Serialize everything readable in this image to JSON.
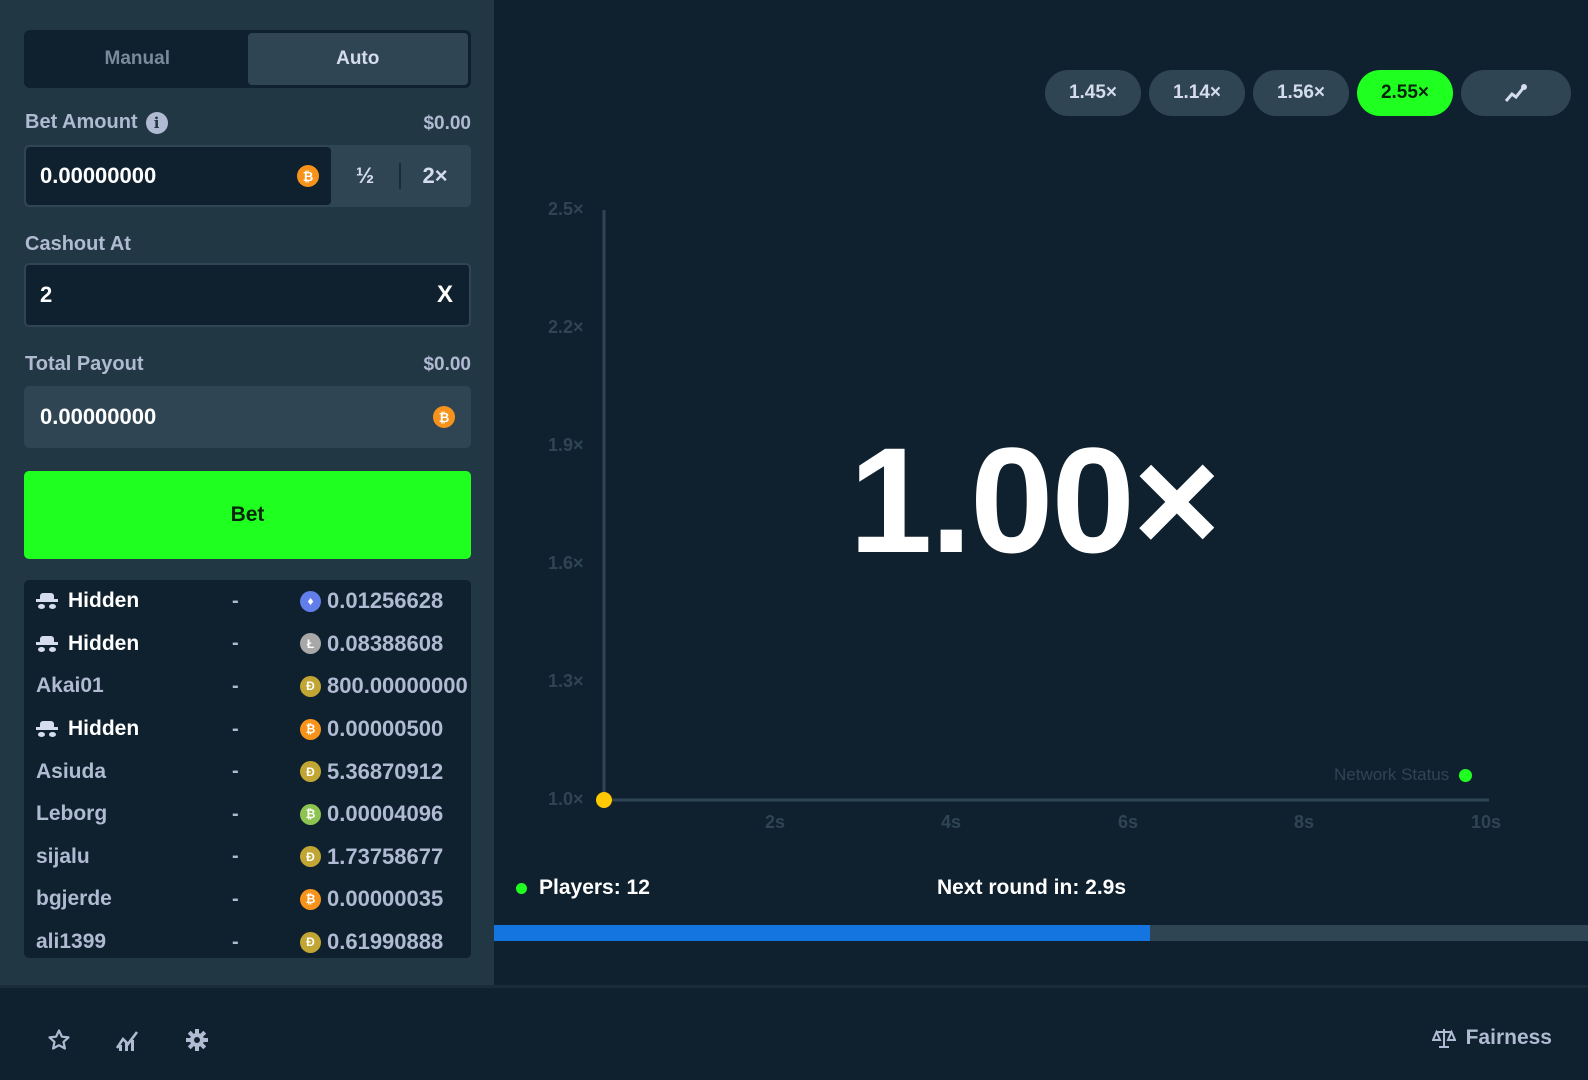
{
  "tabs": {
    "manual": "Manual",
    "auto": "Auto"
  },
  "bet_amount": {
    "label": "Bet Amount",
    "usd": "$0.00",
    "value": "0.00000000",
    "half": "½",
    "double": "2×"
  },
  "cashout": {
    "label": "Cashout At",
    "value": "2",
    "clear": "X"
  },
  "payout": {
    "label": "Total Payout",
    "usd": "$0.00",
    "value": "0.00000000"
  },
  "bet_button": "Bet",
  "players": [
    {
      "name": "Hidden",
      "hidden": true,
      "dash": "-",
      "coin": "eth",
      "amount": "0.01256628"
    },
    {
      "name": "Hidden",
      "hidden": true,
      "dash": "-",
      "coin": "ltc",
      "amount": "0.08388608"
    },
    {
      "name": "Akai01",
      "hidden": false,
      "dash": "-",
      "coin": "doge",
      "amount": "800.00000000"
    },
    {
      "name": "Hidden",
      "hidden": true,
      "dash": "-",
      "coin": "btc",
      "amount": "0.00000500"
    },
    {
      "name": "Asiuda",
      "hidden": false,
      "dash": "-",
      "coin": "doge",
      "amount": "5.36870912"
    },
    {
      "name": "Leborg",
      "hidden": false,
      "dash": "-",
      "coin": "bch",
      "amount": "0.00004096"
    },
    {
      "name": "sijalu",
      "hidden": false,
      "dash": "-",
      "coin": "doge",
      "amount": "1.73758677"
    },
    {
      "name": "bgjerde",
      "hidden": false,
      "dash": "-",
      "coin": "btc",
      "amount": "0.00000035"
    },
    {
      "name": "ali1399",
      "hidden": false,
      "dash": "-",
      "coin": "doge",
      "amount": "0.61990888"
    }
  ],
  "coin_colors": {
    "eth": "#627eea",
    "ltc": "#a8a8a8",
    "doge": "#c2a633",
    "btc": "#f7931a",
    "bch": "#8dc351"
  },
  "coin_glyphs": {
    "eth": "♦",
    "ltc": "Ł",
    "doge": "Ð",
    "btc": "₿",
    "bch": "₿"
  },
  "history": [
    "1.45×",
    "1.14×",
    "1.56×",
    "2.55×"
  ],
  "current_multiplier": "1.00×",
  "graph": {
    "y_ticks": [
      "2.5×",
      "2.2×",
      "1.9×",
      "1.6×",
      "1.3×",
      "1.0×"
    ],
    "x_ticks": [
      "2s",
      "4s",
      "6s",
      "8s",
      "10s"
    ]
  },
  "network_status": "Network Status",
  "players_count": "Players: 12",
  "next_round": "Next round in: 2.9s",
  "progress": 0.6,
  "footer": {
    "fairness": "Fairness"
  },
  "colors": {
    "accent_green": "#1fff20",
    "progress_blue": "#1475e1",
    "panel": "#213743",
    "bg": "#0f212e"
  }
}
